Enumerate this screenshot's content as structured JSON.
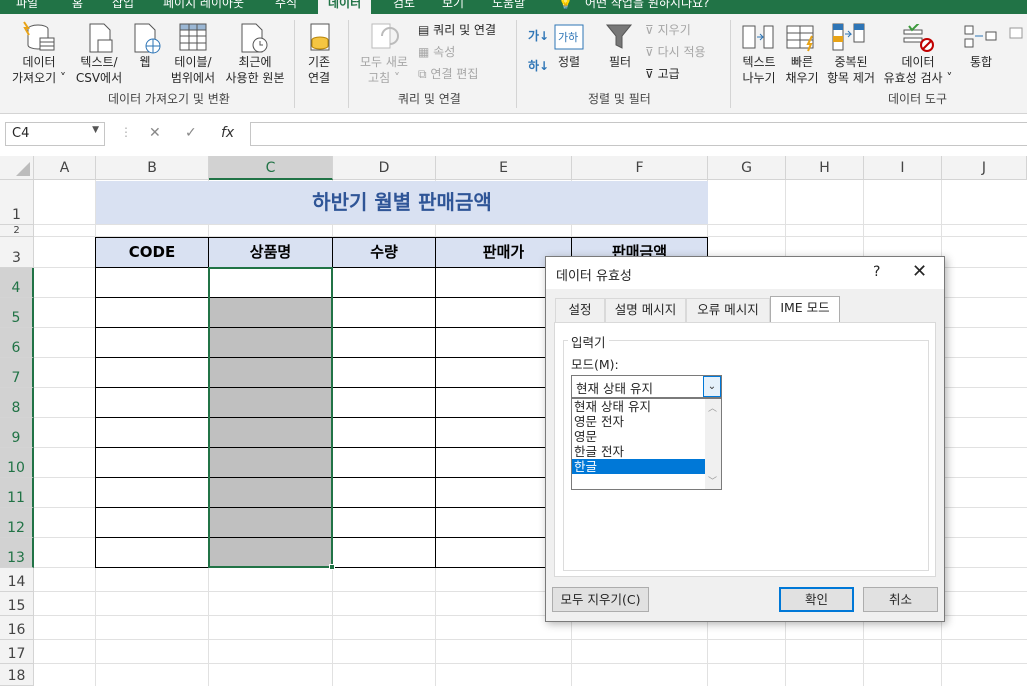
{
  "ribbon_tabs": [
    "파일",
    "홈",
    "삽입",
    "페이지 레이아웃",
    "수식",
    "데이터",
    "검토",
    "보기",
    "도움말",
    "어떤 작업을 원하시나요?"
  ],
  "ribbon": {
    "get_data_line1": "데이터",
    "get_data_line2": "가져오기 ˅",
    "text_csv_line1": "텍스트/",
    "text_csv_line2": "CSV에서",
    "web": "웹",
    "table_range_line1": "테이블/",
    "table_range_line2": "범위에서",
    "recent_line1": "최근에",
    "recent_line2": "사용한 원본",
    "existing_line1": "기존",
    "existing_line2": "연결",
    "group_get_transform": "데이터 가져오기 및 변환",
    "refresh_line1": "모두 새로",
    "refresh_line2": "고침 ˅",
    "queries_connections": "쿼리 및 연결",
    "properties": "속성",
    "edit_links": "연결 편집",
    "group_queries": "쿼리 및 연결",
    "sort_az": "가↓",
    "sort_za": "하↓",
    "sort": "정렬",
    "filter": "필터",
    "clear": "지우기",
    "reapply": "다시 적용",
    "advanced": "고급",
    "group_sort_filter": "정렬 및 필터",
    "text_to_columns_line1": "텍스트",
    "text_to_columns_line2": "나누기",
    "flash_fill_line1": "빠른",
    "flash_fill_line2": "채우기",
    "remove_dup_line1": "중복된",
    "remove_dup_line2": "항목 제거",
    "validation_line1": "데이터",
    "validation_line2": "유효성 검사 ˅",
    "consolidate": "통합",
    "group_data_tools": "데이터 도구"
  },
  "formula_bar": {
    "name_box": "C4",
    "formula": ""
  },
  "columns": [
    "A",
    "B",
    "C",
    "D",
    "E",
    "F",
    "G",
    "H",
    "I",
    "J"
  ],
  "rows": [
    "1",
    "2",
    "3",
    "4",
    "5",
    "6",
    "7",
    "8",
    "9",
    "10",
    "11",
    "12",
    "13",
    "14",
    "15",
    "16",
    "17",
    "18"
  ],
  "sheet": {
    "title": "하반기 월별 판매금액",
    "headers": [
      "CODE",
      "상품명",
      "수량",
      "판매가",
      "판매금액"
    ]
  },
  "dialog": {
    "title": "데이터 유효성",
    "help": "?",
    "close": "✕",
    "tabs": [
      "설정",
      "설명 메시지",
      "오류 메시지",
      "IME 모드"
    ],
    "active_tab": "IME 모드",
    "group_label": "입력기",
    "mode_label": "모드(M):",
    "mode_value": "현재 상태 유지",
    "options": [
      "현재 상태 유지",
      "영문 전자",
      "영문",
      "한글 전자",
      "한글"
    ],
    "selected_option": "한글",
    "clear_all": "모두 지우기(C)",
    "ok": "확인",
    "cancel": "취소"
  }
}
